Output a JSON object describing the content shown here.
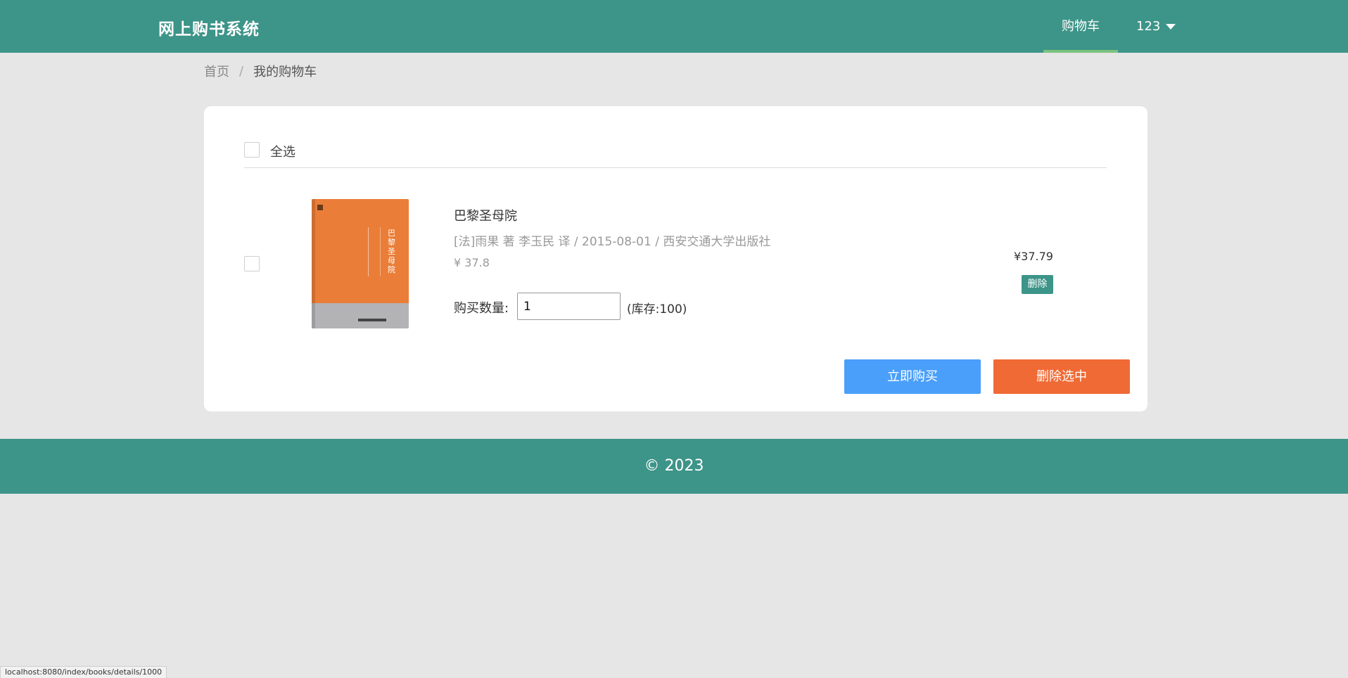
{
  "header": {
    "logo": "网上购书系统",
    "nav_cart": "购物车",
    "user_name": "123",
    "colors": {
      "bar": "#3d9488",
      "active_underline": "#7cc27f"
    }
  },
  "breadcrumb": {
    "home": "首页",
    "separator": "/",
    "current": "我的购物车"
  },
  "cart": {
    "select_all_label": "全选",
    "items": [
      {
        "cover_title": "巴黎圣母院",
        "title": "巴黎圣母院",
        "meta": "[法]雨果 著 李玉民 译 / 2015-08-01 / 西安交通大学出版社",
        "price": "¥ 37.8",
        "quantity_label": "购买数量:",
        "quantity": "1",
        "stock": "(库存:100)",
        "subtotal": "¥37.79",
        "delete_label": "删除"
      }
    ],
    "buy_now_label": "立即购买",
    "delete_selected_label": "删除选中",
    "colors": {
      "buy": "#4a9ffa",
      "delete_selected": "#f06a35",
      "delete_small": "#3d9488"
    }
  },
  "footer": {
    "text": "© 2023"
  },
  "statusbar": {
    "url": "localhost:8080/index/books/details/1000"
  }
}
